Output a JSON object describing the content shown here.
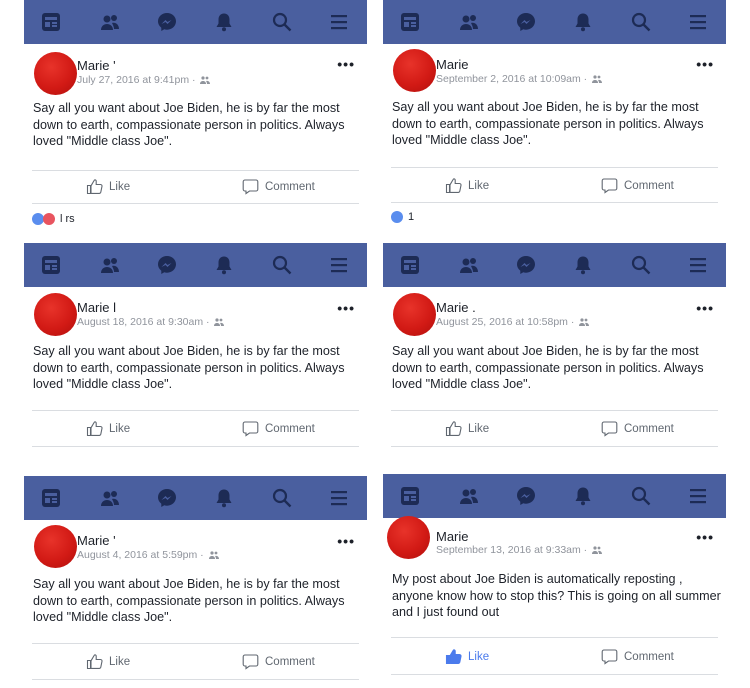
{
  "nav_icons": [
    "news-feed-icon",
    "friends-icon",
    "messenger-icon",
    "notifications-icon",
    "search-icon",
    "menu-icon"
  ],
  "colors": {
    "navbar": "#4a5f9f",
    "avatar": "#d21a15",
    "liked": "#4b7bec"
  },
  "posts": [
    {
      "author": "Marie '",
      "date": "July 27, 2016 at 9:41pm",
      "text": "Say all you want about Joe Biden, he is by far the most down to earth, compassionate person in politics. Always loved \"Middle class Joe\".",
      "like": "Like",
      "comment": "Comment",
      "reactions_text": "l                    rs"
    },
    {
      "author": "Marie",
      "date": "September 2, 2016 at 10:09am",
      "text": "Say all you want about Joe Biden, he is by far the most down to earth, compassionate person in politics. Always loved \"Middle class Joe\".",
      "like": "Like",
      "comment": "Comment",
      "reactions_text": "1"
    },
    {
      "author": "Marie l",
      "date": "August 18, 2016 at 9:30am",
      "text": "Say all you want about Joe Biden, he is by far the most down to earth, compassionate person in politics. Always loved \"Middle class Joe\".",
      "like": "Like",
      "comment": "Comment"
    },
    {
      "author": "Marie .",
      "date": "August 25, 2016 at 10:58pm",
      "text": "Say all you want about Joe Biden, he is by far the most down to earth, compassionate person in politics. Always loved \"Middle class Joe\".",
      "like": "Like",
      "comment": "Comment"
    },
    {
      "author": "Marie '",
      "date": "August 4, 2016 at 5:59pm",
      "text": "Say all you want about Joe Biden, he is by far the most down to earth, compassionate person in politics. Always loved \"Middle class Joe\".",
      "like": "Like",
      "comment": "Comment"
    },
    {
      "author": "Marie",
      "date": "September 13, 2016 at 9:33am",
      "text": "My post about Joe Biden is automatically reposting , anyone know how to stop this? This is going on all summer and I just found out",
      "like": "Like",
      "comment": "Comment",
      "liked": true
    }
  ]
}
